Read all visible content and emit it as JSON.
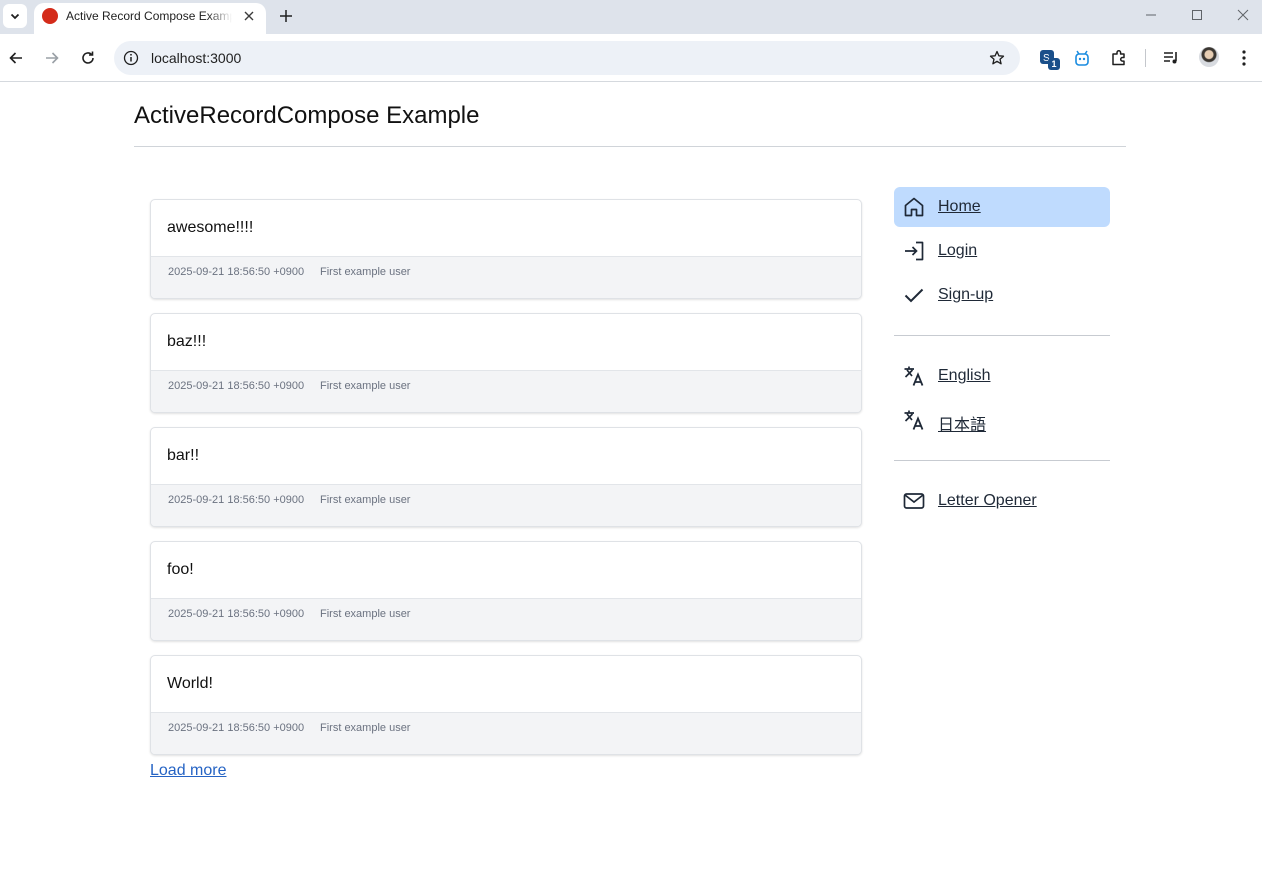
{
  "browser": {
    "tab_title": "Active Record Compose Example",
    "url": "localhost:3000",
    "extension_badge": "1"
  },
  "page": {
    "title": "ActiveRecordCompose Example"
  },
  "posts": [
    {
      "body": "awesome!!!!",
      "date": "2025-09-21 18:56:50 +0900",
      "author": "First example user"
    },
    {
      "body": "baz!!!",
      "date": "2025-09-21 18:56:50 +0900",
      "author": "First example user"
    },
    {
      "body": "bar!!",
      "date": "2025-09-21 18:56:50 +0900",
      "author": "First example user"
    },
    {
      "body": "foo!",
      "date": "2025-09-21 18:56:50 +0900",
      "author": "First example user"
    },
    {
      "body": "World!",
      "date": "2025-09-21 18:56:50 +0900",
      "author": "First example user"
    }
  ],
  "load_more_label": "Load more",
  "menu": {
    "nav": [
      {
        "label": "Home",
        "icon": "home-icon",
        "active": true
      },
      {
        "label": "Login",
        "icon": "login-icon",
        "active": false
      },
      {
        "label": "Sign-up",
        "icon": "check-icon",
        "active": false
      }
    ],
    "languages": [
      {
        "label": "English",
        "icon": "translate-icon"
      },
      {
        "label": "日本語",
        "icon": "translate-icon"
      }
    ],
    "tools": [
      {
        "label": "Letter Opener",
        "icon": "mail-icon"
      }
    ]
  },
  "colors": {
    "active_menu_bg": "#bfdbfe",
    "link": "#2563c4",
    "favicon": "#d42b1a"
  }
}
